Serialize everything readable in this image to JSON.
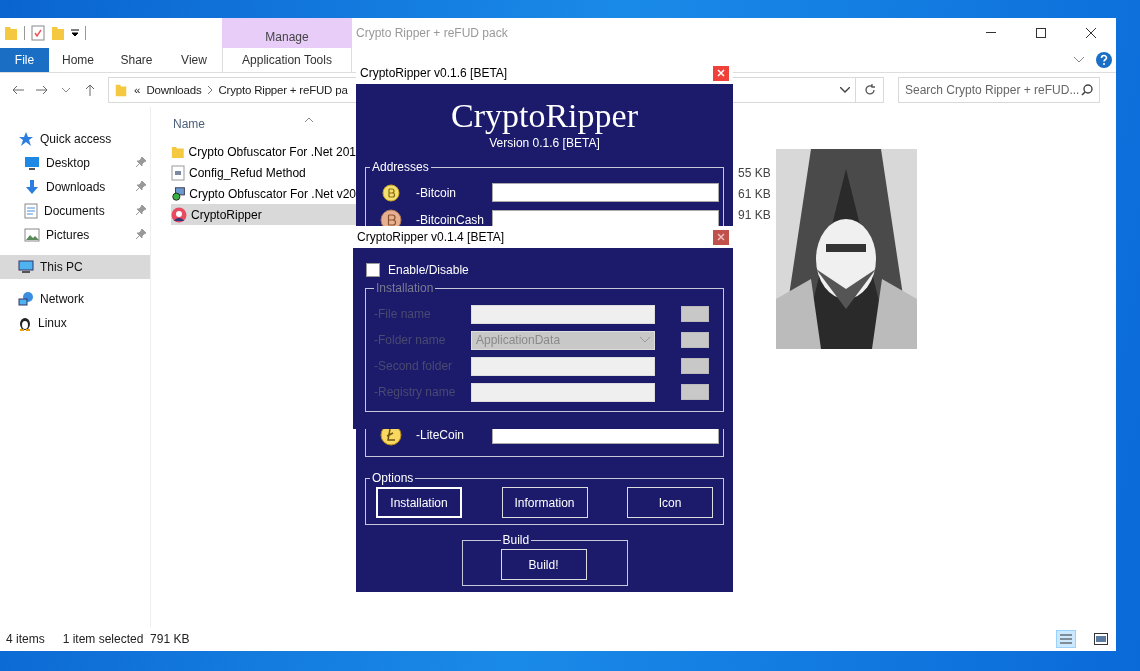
{
  "explorer": {
    "title": "Crypto Ripper + reFUD pack",
    "ribbon": {
      "context_group": "Manage",
      "tabs": [
        {
          "label": "File",
          "kind": "file"
        },
        {
          "label": "Home",
          "kind": "tab"
        },
        {
          "label": "Share",
          "kind": "tab"
        },
        {
          "label": "View",
          "kind": "tab"
        },
        {
          "label": "Application Tools",
          "kind": "context"
        }
      ]
    },
    "address": {
      "overflow": "«",
      "path": [
        "Downloads",
        "Crypto Ripper + reFUD pa"
      ]
    },
    "search": {
      "placeholder": "Search Crypto Ripper + reFUD..."
    },
    "sidebar": {
      "items": [
        {
          "label": "Quick access",
          "kind": "star",
          "pinned": false,
          "selected": false
        },
        {
          "label": "Desktop",
          "kind": "desktop",
          "pinned": true,
          "selected": false
        },
        {
          "label": "Downloads",
          "kind": "download",
          "pinned": true,
          "selected": false
        },
        {
          "label": "Documents",
          "kind": "document",
          "pinned": true,
          "selected": false
        },
        {
          "label": "Pictures",
          "kind": "picture",
          "pinned": true,
          "selected": false
        },
        {
          "label": "This PC",
          "kind": "computer",
          "pinned": false,
          "selected": true
        },
        {
          "label": "Network",
          "kind": "network",
          "pinned": false,
          "selected": false
        },
        {
          "label": "Linux",
          "kind": "penguin",
          "pinned": false,
          "selected": false
        }
      ]
    },
    "columns": [
      "Name"
    ],
    "files": [
      {
        "name": "Crypto Obfuscator For .Net 201",
        "kind": "folder",
        "selected": false
      },
      {
        "name": "Config_Refud Method",
        "kind": "document",
        "size": "55 KB",
        "selected": false
      },
      {
        "name": "Crypto Obfuscator For .Net v20",
        "kind": "installer",
        "size": "61 KB",
        "selected": false
      },
      {
        "name": "CryptoRipper",
        "kind": "app",
        "size": "91 KB",
        "selected": true
      }
    ],
    "status_bar": {
      "count": "4 items",
      "selection": "1 item selected  791 KB"
    }
  },
  "builder_main": {
    "title": "CryptoRipper v0.1.6 [BETA]",
    "heading": "CryptoRipper",
    "version": "Version 0.1.6 [BETA]",
    "addresses": {
      "label": "Addresses",
      "top_rows": [
        {
          "kind": "bitcoin",
          "label": "-Bitcoin"
        },
        {
          "kind": "bitcoincash",
          "label": "-BitcoinCash"
        }
      ],
      "bottom_rows": [
        {
          "kind": "litecoin",
          "label": "-LiteCoin"
        }
      ]
    },
    "options": {
      "label": "Options",
      "buttons": [
        {
          "label": "Installation",
          "selected": true
        },
        {
          "label": "Information",
          "selected": false
        },
        {
          "label": "Icon",
          "selected": false
        }
      ]
    },
    "build": {
      "label": "Build",
      "button": "Build!"
    }
  },
  "builder_install": {
    "title": "CryptoRipper v0.1.4 [BETA]",
    "enable": {
      "label": "Enable/Disable",
      "checked": false
    },
    "installation": {
      "label": "Installation",
      "disabled": true,
      "fields": [
        {
          "label": "-File name",
          "kind": "text"
        },
        {
          "label": "-Folder name",
          "kind": "select",
          "value": "ApplicationData"
        },
        {
          "label": "-Second folder",
          "kind": "text"
        },
        {
          "label": "-Registry name",
          "kind": "text"
        }
      ]
    }
  }
}
